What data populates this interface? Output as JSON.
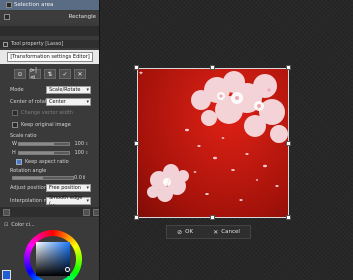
{
  "layers": {
    "selection_area": "Selection area",
    "rectangle": "Rectangle"
  },
  "tool_property": {
    "title": "Tool property [Lasso]"
  },
  "transform": {
    "title": "[Transformation settings Editor]",
    "icons": [
      "confirm-icon",
      "flip-horizontal-icon",
      "flip-vertical-icon",
      "ok-icon",
      "cancel-icon"
    ],
    "icon_glyphs": [
      "⊙",
      "⊳|⊲",
      "⇅",
      "✓",
      "✕"
    ]
  },
  "settings": {
    "mode_label": "Mode",
    "mode_value": "Scale/Rotate",
    "center_label": "Center of rotation",
    "center_value": "Center",
    "change_vector_width": "Change vector width",
    "keep_original": "Keep original image",
    "scale_ratio_label": "Scale ratio",
    "w_label": "W",
    "w_value": "100",
    "h_label": "H",
    "h_value": "100",
    "keep_aspect": "Keep aspect ratio",
    "rotation_label": "Rotation angle",
    "rotation_value": "0.0",
    "adjust_label": "Adjust position",
    "adjust_value": "Free position",
    "interp_label": "Interpolation method",
    "interp_value": "Smooth edge (..."
  },
  "color_panel": {
    "header": "Color ci..."
  },
  "actions": {
    "ok": "OK",
    "cancel": "Cancel"
  },
  "colors": {
    "selected_layer": "#5a6b84",
    "red_bg": "#c21a10",
    "blossom": "#f7e6ea"
  }
}
